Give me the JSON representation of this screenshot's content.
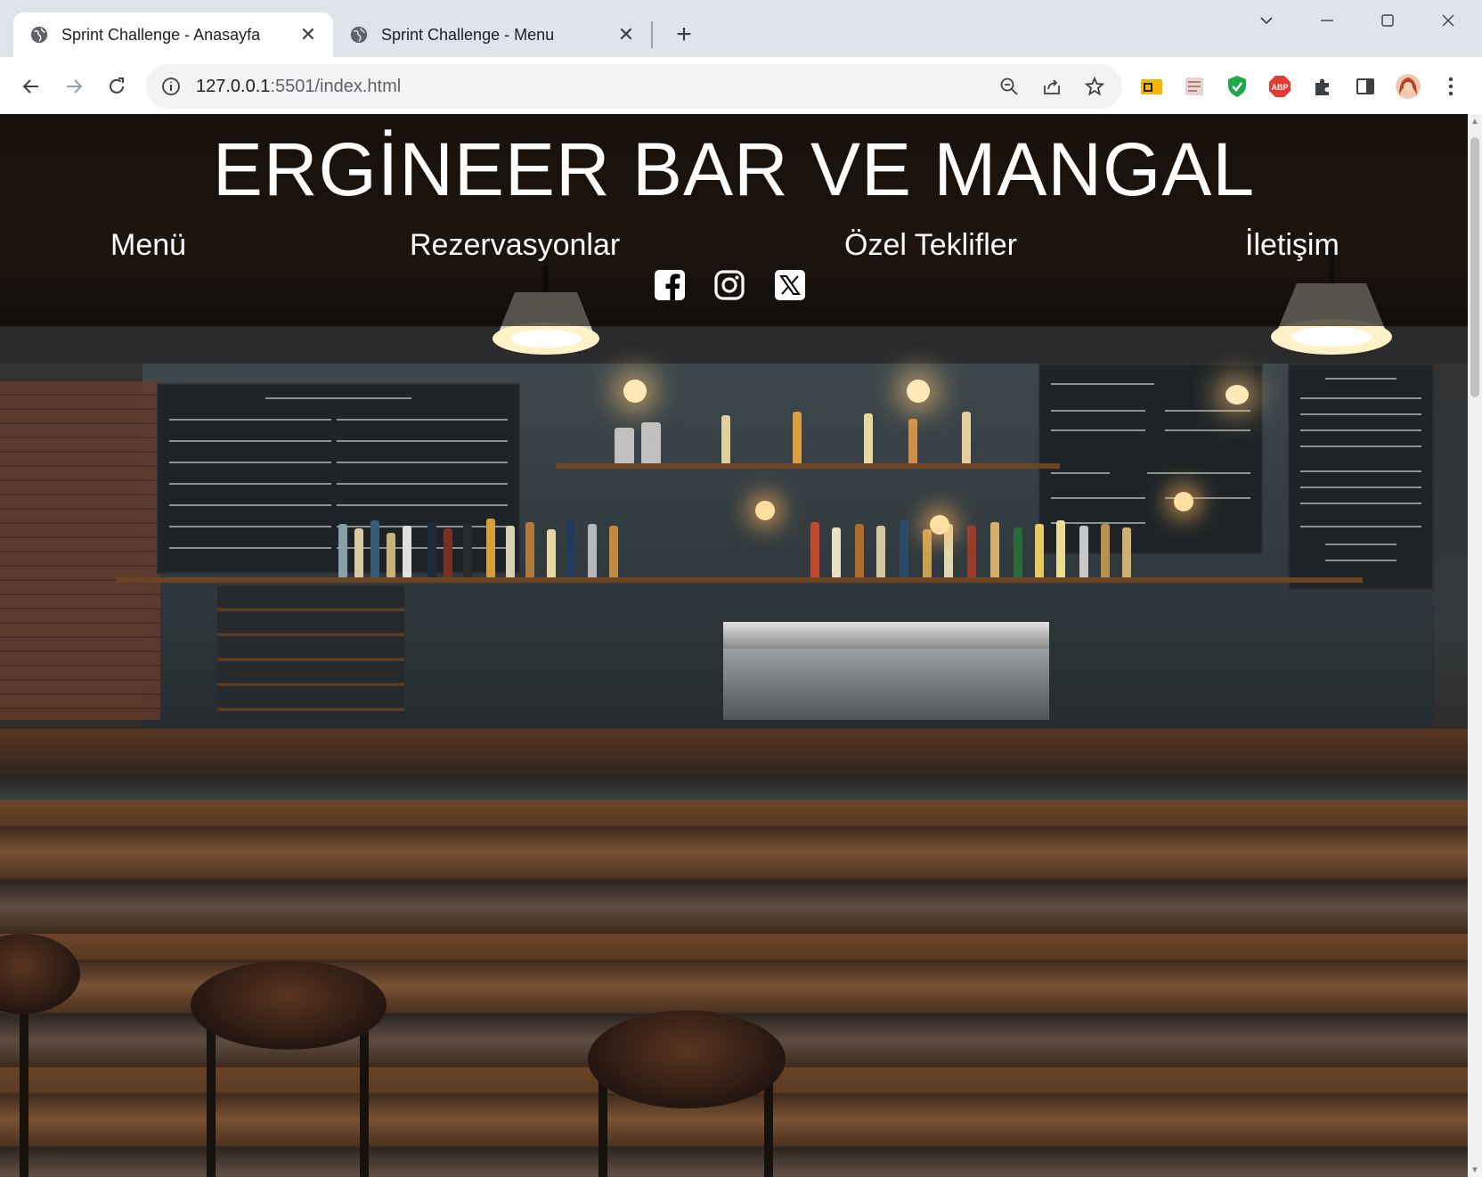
{
  "browser": {
    "tabs": [
      {
        "title": "Sprint Challenge - Anasayfa",
        "active": true
      },
      {
        "title": "Sprint Challenge - Menu",
        "active": false
      }
    ],
    "url_host": "127.0.0.1",
    "url_rest": ":5501/index.html",
    "icons": {
      "back": "arrow-left-icon",
      "forward": "arrow-right-icon",
      "reload": "reload-icon",
      "site_info": "info-icon",
      "zoom": "zoom-out-icon",
      "share": "share-icon",
      "bookmark": "star-icon",
      "extensions": "puzzle-icon",
      "side_panel": "side-panel-icon",
      "menu": "kebab-menu-icon"
    }
  },
  "site": {
    "title": "ERGİNEER BAR VE MANGAL",
    "nav": [
      "Menü",
      "Rezervasyonlar",
      "Özel Teklifler",
      "İletişim"
    ],
    "social": [
      "facebook-icon",
      "instagram-icon",
      "x-twitter-icon"
    ]
  },
  "colors": {
    "header_overlay": "rgba(0,0,0,0.6)",
    "text": "#ffffff",
    "tabstrip": "#dfe3ea"
  }
}
